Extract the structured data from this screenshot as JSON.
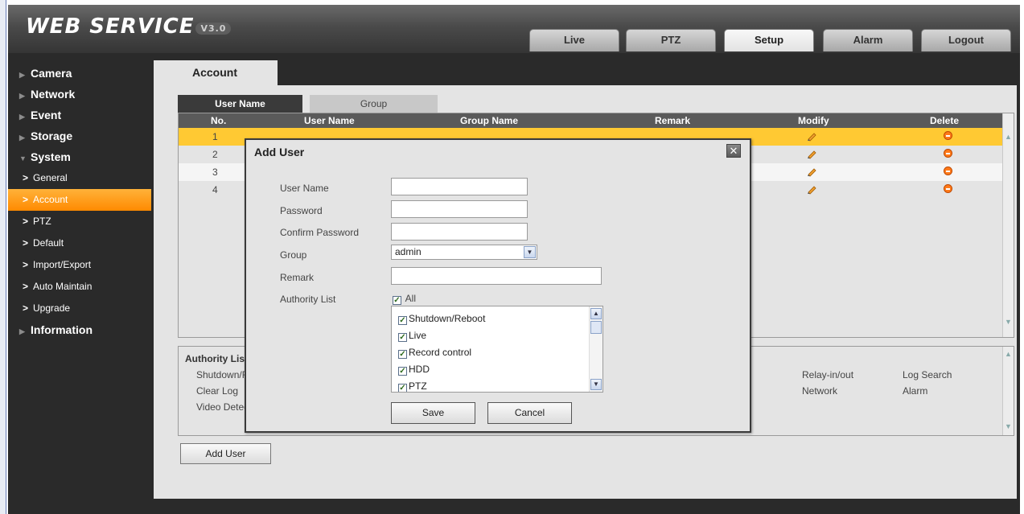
{
  "header": {
    "logo_text": "WEB SERVICE",
    "version_badge": "V3.0",
    "nav_tabs": [
      {
        "label": "Live"
      },
      {
        "label": "PTZ"
      },
      {
        "label": "Setup"
      },
      {
        "label": "Alarm"
      },
      {
        "label": "Logout"
      }
    ],
    "active_tab": "Setup"
  },
  "sidebar": {
    "categories": [
      {
        "label": "Camera"
      },
      {
        "label": "Network"
      },
      {
        "label": "Event"
      },
      {
        "label": "Storage"
      },
      {
        "label": "System"
      }
    ],
    "system_items": [
      {
        "label": "General"
      },
      {
        "label": "Account"
      },
      {
        "label": "PTZ"
      },
      {
        "label": "Default"
      },
      {
        "label": "Import/Export"
      },
      {
        "label": "Auto Maintain"
      },
      {
        "label": "Upgrade"
      }
    ],
    "last_category": {
      "label": "Information"
    },
    "active_item": "Account"
  },
  "main": {
    "page_title": "Account",
    "subtabs": [
      {
        "label": "User Name"
      },
      {
        "label": "Group"
      }
    ],
    "table": {
      "columns": [
        "No.",
        "User Name",
        "Group Name",
        "Remark",
        "Modify",
        "Delete"
      ],
      "rows": [
        {
          "no": "1"
        },
        {
          "no": "2"
        },
        {
          "no": "3"
        },
        {
          "no": "4"
        }
      ]
    },
    "authority_panel": {
      "title": "Authority List",
      "items_left": [
        "Shutdown/R",
        "Clear Log",
        "Video Detec"
      ],
      "items_right_col1": [
        "Relay-in/out",
        "Network"
      ],
      "items_right_col2": [
        "Log Search",
        "Alarm"
      ]
    },
    "add_user_button": "Add User"
  },
  "modal": {
    "title": "Add User",
    "close_symbol": "✕",
    "fields": {
      "user_name_label": "User Name",
      "user_name_value": "",
      "password_label": "Password",
      "password_value": "",
      "confirm_password_label": "Confirm Password",
      "confirm_password_value": "",
      "group_label": "Group",
      "group_value": "admin",
      "remark_label": "Remark",
      "remark_value": "",
      "authority_list_label": "Authority List"
    },
    "all_checkbox": {
      "label": "All",
      "checked": true
    },
    "authority_items": [
      {
        "label": "Shutdown/Reboot",
        "checked": true
      },
      {
        "label": "Live",
        "checked": true
      },
      {
        "label": "Record control",
        "checked": true
      },
      {
        "label": "HDD",
        "checked": true
      },
      {
        "label": "PTZ",
        "checked": true
      }
    ],
    "save_button": "Save",
    "cancel_button": "Cancel"
  },
  "colors": {
    "accent_orange": "#ff8a00",
    "selected_row": "#ffc933",
    "header_bg": "#4a4a4a",
    "panel_bg": "#e4e4e4"
  }
}
